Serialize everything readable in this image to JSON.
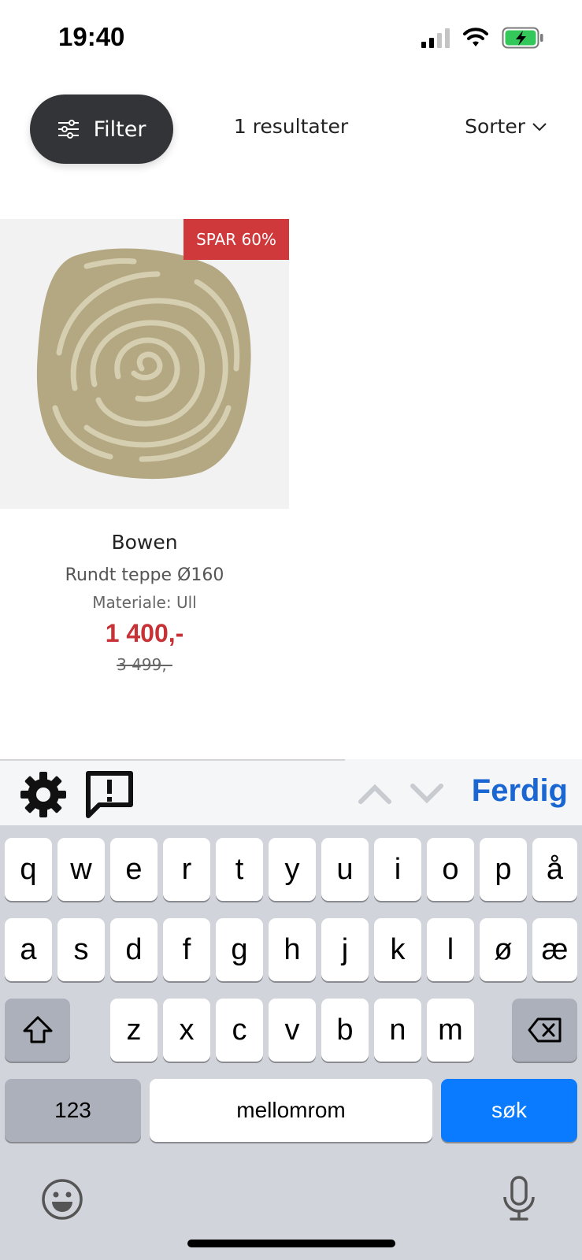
{
  "status_bar": {
    "time": "19:40"
  },
  "toolbar": {
    "filter_label": "Filter",
    "results_label": "1 resultater",
    "sort_label": "Sorter"
  },
  "product": {
    "badge": "SPAR 60%",
    "name": "Bowen",
    "description": "Rundt teppe Ø160",
    "material": "Materiale: Ull",
    "price": "1 400,-",
    "old_price": "3 499,-"
  },
  "accessory_bar": {
    "done_label": "Ferdig",
    "icons": [
      "gear-icon",
      "feedback-icon",
      "chevron-up-icon",
      "chevron-down-icon"
    ]
  },
  "keyboard": {
    "row1": [
      "q",
      "w",
      "e",
      "r",
      "t",
      "y",
      "u",
      "i",
      "o",
      "p",
      "å"
    ],
    "row2": [
      "a",
      "s",
      "d",
      "f",
      "g",
      "h",
      "j",
      "k",
      "l",
      "ø",
      "æ"
    ],
    "row3": [
      "z",
      "x",
      "c",
      "v",
      "b",
      "n",
      "m"
    ],
    "numbers_label": "123",
    "space_label": "mellomrom",
    "search_label": "søk"
  },
  "colors": {
    "sale_red": "#d0393c",
    "price_red": "#c63236",
    "done_blue": "#1a66d2",
    "search_blue": "#0a7bff",
    "filter_dark": "#333438"
  }
}
